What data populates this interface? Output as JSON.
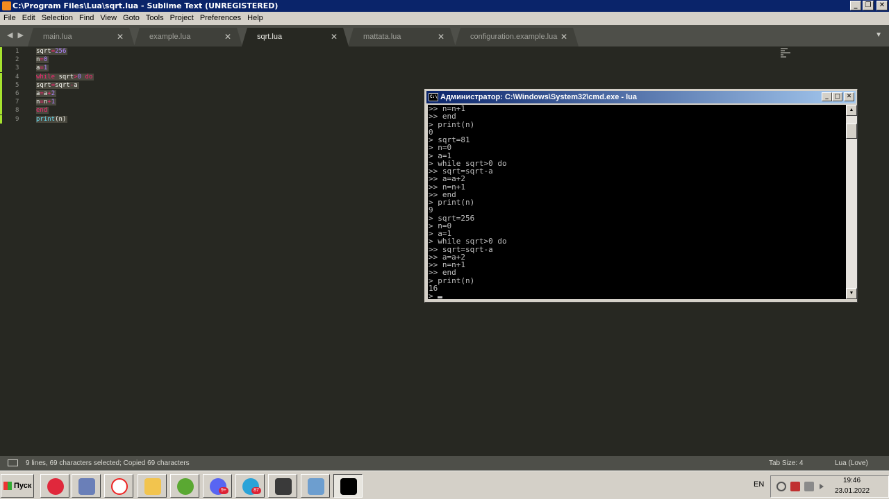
{
  "window": {
    "title": "C:\\Program Files\\Lua\\sqrt.lua - Sublime Text (UNREGISTERED)",
    "minimize": "_",
    "restore": "❐",
    "close": "✕"
  },
  "menu": [
    "File",
    "Edit",
    "Selection",
    "Find",
    "View",
    "Goto",
    "Tools",
    "Project",
    "Preferences",
    "Help"
  ],
  "tabs": [
    {
      "label": "main.lua",
      "close": "✕"
    },
    {
      "label": "example.lua",
      "close": "✕"
    },
    {
      "label": "sqrt.lua",
      "close": "✕"
    },
    {
      "label": "mattata.lua",
      "close": "✕"
    },
    {
      "label": "configuration.example.lua",
      "close": "✕"
    }
  ],
  "tab_nav": "◀ ▶",
  "tab_menu": "▼",
  "editor": {
    "line_numbers": [
      "1",
      "2",
      "3",
      "4",
      "5",
      "6",
      "7",
      "8",
      "9"
    ],
    "code": [
      "sqrt=256",
      "n=0",
      "a=1",
      "while sqrt>0 do",
      "sqrt=sqrt-a",
      "a=a+2",
      "n=n+1",
      "end",
      "print(n)"
    ]
  },
  "cmd": {
    "title": "Администратор: C:\\Windows\\System32\\cmd.exe - lua",
    "icon_text": "C:\\",
    "minimize": "_",
    "maximize": "□",
    "close": "✕",
    "scroll_up": "▲",
    "scroll_down": "▼",
    "lines": [
      ">> n=n+1",
      ">> end",
      "> print(n)",
      "0",
      "> sqrt=81",
      "> n=0",
      "> a=1",
      "> while sqrt>0 do",
      ">> sqrt=sqrt-a",
      ">> a=a+2",
      ">> n=n+1",
      ">> end",
      "> print(n)",
      "9",
      "> sqrt=256",
      "> n=0",
      "> a=1",
      "> while sqrt>0 do",
      ">> sqrt=sqrt-a",
      ">> a=a+2",
      ">> n=n+1",
      ">> end",
      "> print(n)",
      "16",
      "> "
    ]
  },
  "status": {
    "text": "9 lines, 69 characters selected; Copied 69 characters",
    "tab_size": "Tab Size: 4",
    "syntax": "Lua (Love)"
  },
  "taskbar": {
    "start": "Пуск",
    "apps": [
      {
        "name": "opera",
        "color": "#e0283c"
      },
      {
        "name": "paint",
        "color": "#6a7fb8"
      },
      {
        "name": "yandex-browser",
        "color": "#ffffff"
      },
      {
        "name": "file-explorer",
        "color": "#f2c44e"
      },
      {
        "name": "utorrent",
        "color": "#5aa832"
      },
      {
        "name": "discord",
        "color": "#5865f2",
        "badge": "9+"
      },
      {
        "name": "telegram",
        "color": "#2aa3d8",
        "badge": "87"
      },
      {
        "name": "sublime-text",
        "color": "#3a3a3a"
      },
      {
        "name": "control-panel",
        "color": "#6d9ecf"
      },
      {
        "name": "cmd",
        "color": "#000000"
      }
    ],
    "language": "EN",
    "time": "19:46",
    "date": "23.01.2022"
  }
}
